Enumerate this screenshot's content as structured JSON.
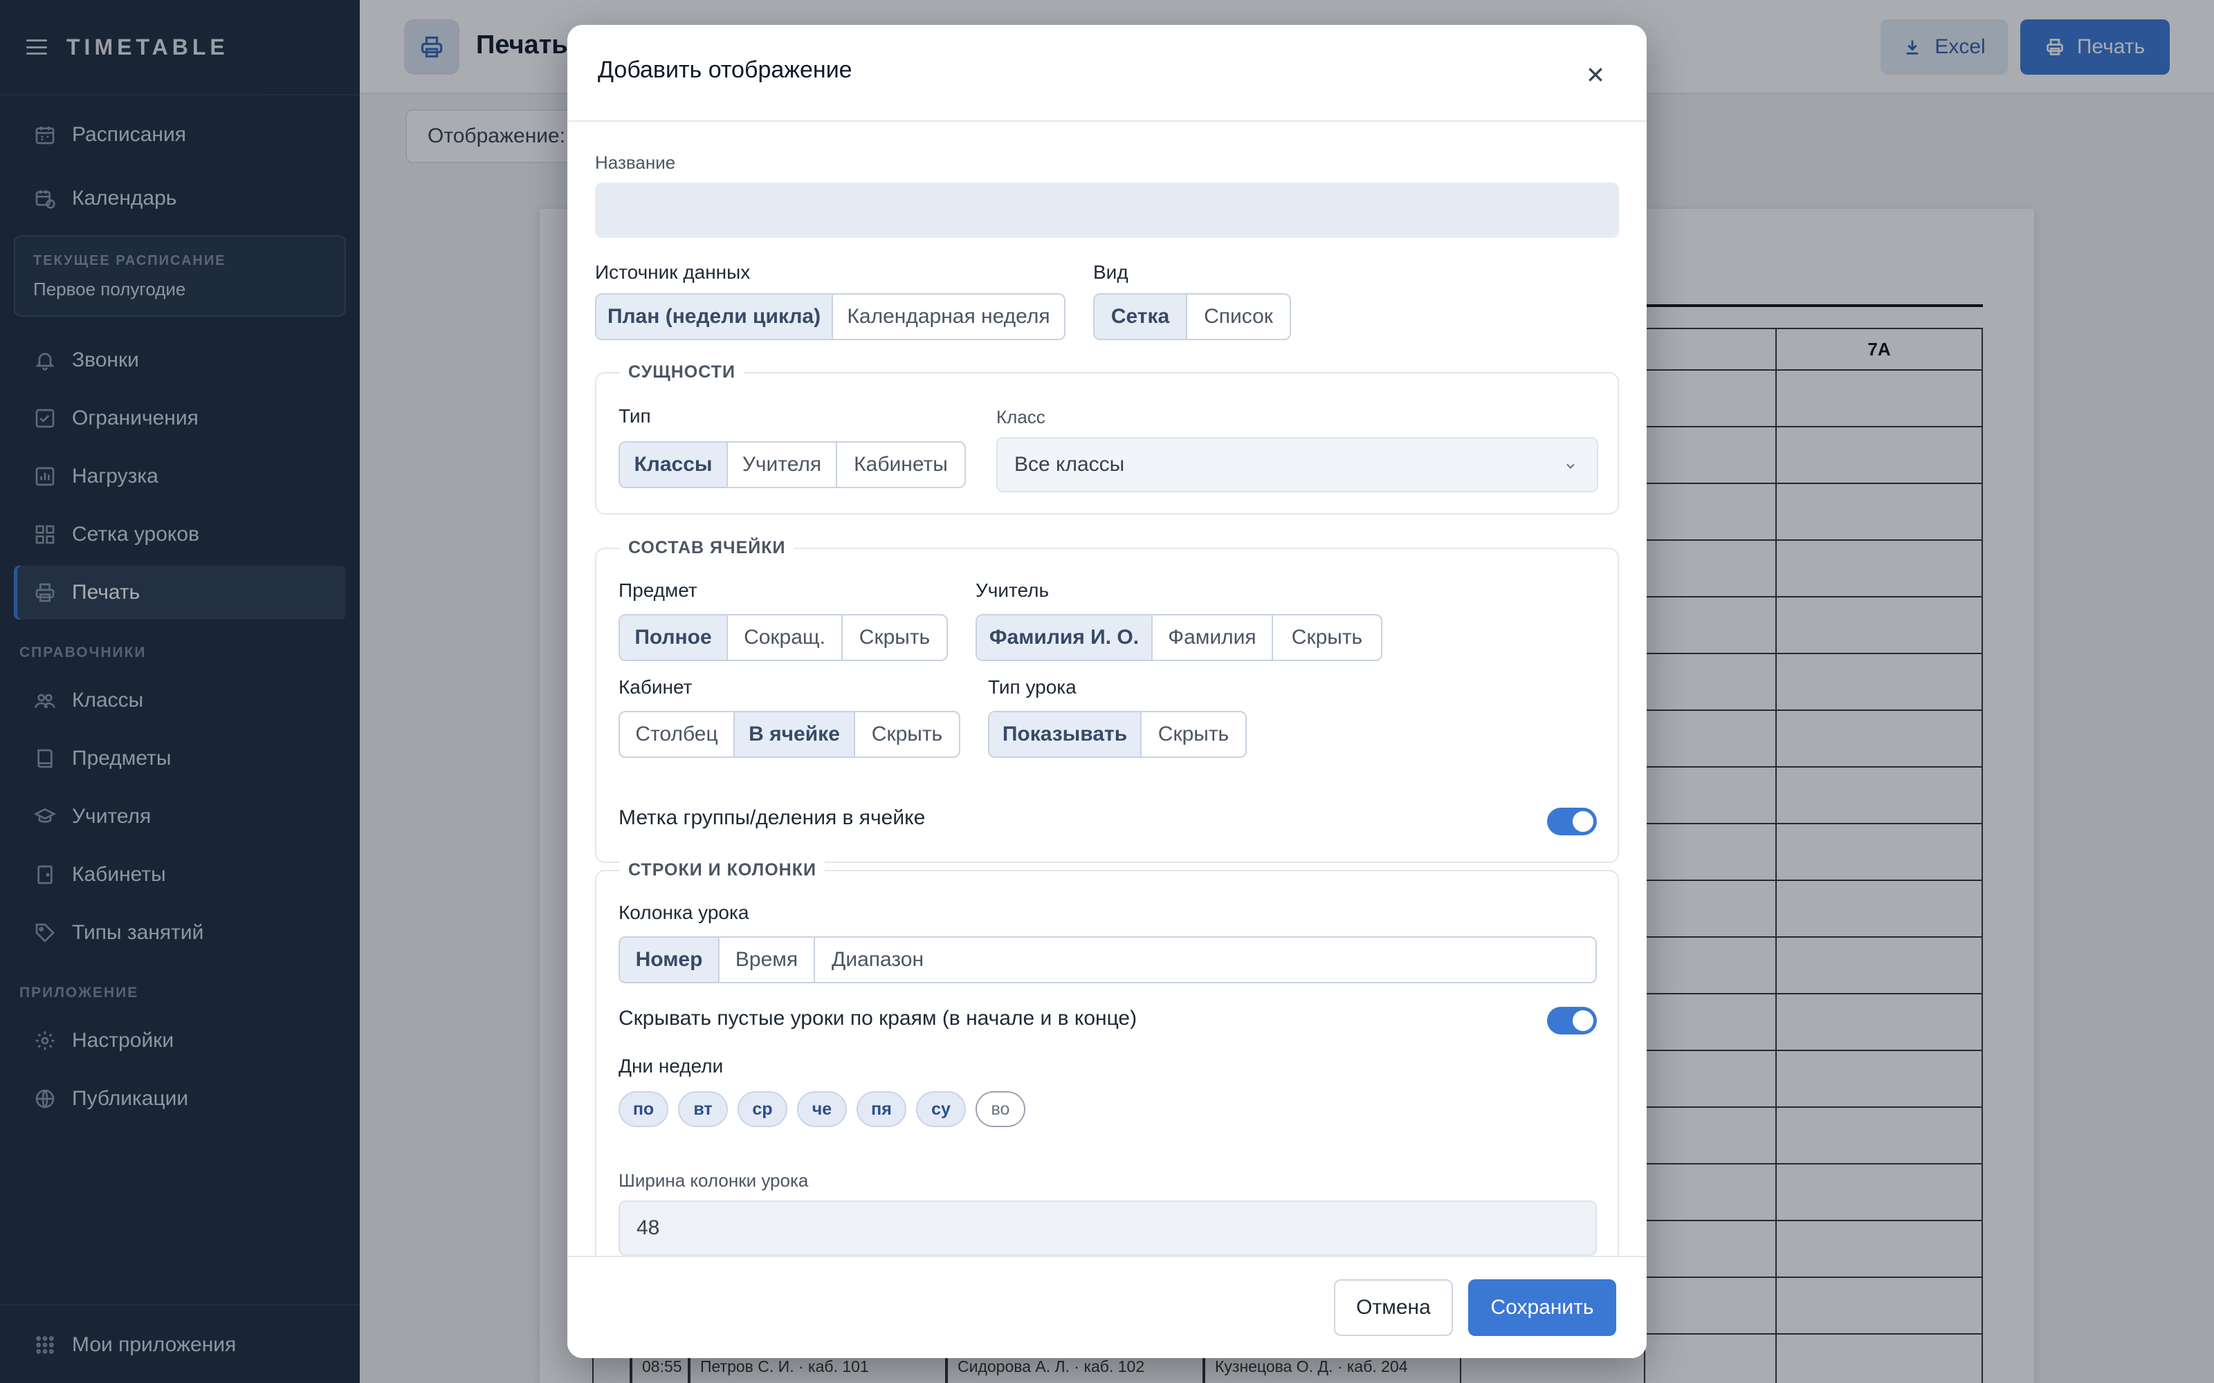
{
  "app": {
    "brand": "TIMETABLE"
  },
  "sidebar": {
    "items_top": [
      {
        "label": "Расписания",
        "icon": "calendar-grid-icon"
      },
      {
        "label": "Календарь",
        "icon": "calendar-clock-icon"
      }
    ],
    "current_schedule": {
      "caption": "ТЕКУЩЕЕ РАСПИСАНИЕ",
      "value": "Первое полугодие"
    },
    "items_main": [
      {
        "label": "Звонки",
        "icon": "bell-icon"
      },
      {
        "label": "Ограничения",
        "icon": "check-square-icon"
      },
      {
        "label": "Нагрузка",
        "icon": "bar-chart-icon"
      },
      {
        "label": "Сетка уроков",
        "icon": "grid-icon"
      },
      {
        "label": "Печать",
        "icon": "printer-icon",
        "active": true
      }
    ],
    "section_refs": "СПРАВОЧНИКИ",
    "items_refs": [
      {
        "label": "Классы",
        "icon": "users-icon"
      },
      {
        "label": "Предметы",
        "icon": "book-icon"
      },
      {
        "label": "Учителя",
        "icon": "graduation-cap-icon"
      },
      {
        "label": "Кабинеты",
        "icon": "door-icon"
      },
      {
        "label": "Типы занятий",
        "icon": "tag-icon"
      }
    ],
    "section_app": "ПРИЛОЖЕНИЕ",
    "items_app": [
      {
        "label": "Настройки",
        "icon": "gear-icon"
      },
      {
        "label": "Публикации",
        "icon": "globe-icon"
      }
    ],
    "footer": {
      "label": "Мои приложения",
      "icon": "apps-grid-icon"
    }
  },
  "page": {
    "title": "Печать",
    "excel_label": "Excel",
    "print_label": "Печать",
    "display_label": "Отображение:",
    "sheet": {
      "grid_header": "7А",
      "bottom_row": [
        "08:55",
        "Петров С. И. · каб. 101",
        "Сидорова А. Л. · каб. 102",
        "Кузнецова О. Д. · каб. 204"
      ]
    }
  },
  "modal": {
    "title": "Добавить отображение",
    "name_label": "Название",
    "name_value": "",
    "source": {
      "label": "Источник данных",
      "options": [
        "План (недели цикла)",
        "Календарная неделя"
      ],
      "selected": 0
    },
    "view": {
      "label": "Вид",
      "options": [
        "Сетка",
        "Список"
      ],
      "selected": 0
    },
    "entities": {
      "legend": "СУЩНОСТИ",
      "type": {
        "label": "Тип",
        "options": [
          "Классы",
          "Учителя",
          "Кабинеты"
        ],
        "selected": 0
      },
      "class": {
        "label": "Класс",
        "value": "Все классы"
      }
    },
    "cell": {
      "legend": "СОСТАВ ЯЧЕЙКИ",
      "subject": {
        "label": "Предмет",
        "options": [
          "Полное",
          "Сокращ.",
          "Скрыть"
        ],
        "selected": 0
      },
      "teacher": {
        "label": "Учитель",
        "options": [
          "Фамилия И. О.",
          "Фамилия",
          "Скрыть"
        ],
        "selected": 0
      },
      "room": {
        "label": "Кабинет",
        "options": [
          "Столбец",
          "В ячейке",
          "Скрыть"
        ],
        "selected": 1
      },
      "lesson_type": {
        "label": "Тип урока",
        "options": [
          "Показывать",
          "Скрыть"
        ],
        "selected": 0
      },
      "group_mark": {
        "label": "Метка группы/деления в ячейке",
        "on": true
      }
    },
    "rows": {
      "legend": "СТРОКИ И КОЛОНКИ",
      "lesson_col": {
        "label": "Колонка урока",
        "options": [
          "Номер",
          "Время",
          "Диапазон"
        ],
        "selected": 0
      },
      "hide_empty": {
        "label": "Скрывать пустые уроки по краям (в начале и в конце)",
        "on": true
      },
      "days": {
        "label": "Дни недели",
        "items": [
          "по",
          "вт",
          "ср",
          "че",
          "пя",
          "су",
          "во"
        ],
        "enabled": [
          true,
          true,
          true,
          true,
          true,
          true,
          false
        ]
      },
      "col_width": {
        "label": "Ширина колонки урока",
        "value": "48"
      }
    },
    "cancel_label": "Отмена",
    "save_label": "Сохранить"
  },
  "colors": {
    "sidebar_bg": "#1f2d3d",
    "accent": "#3a78d4",
    "segment_selected": "#e6ecf6"
  }
}
